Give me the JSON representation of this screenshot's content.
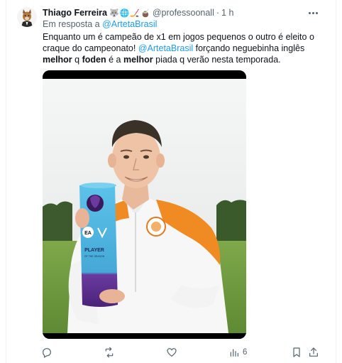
{
  "author": {
    "display_name": "Thiago Ferreira",
    "name_emojis": [
      "🐺",
      "🌐",
      "🏒",
      "🧉"
    ],
    "handle": "@professoonall",
    "separator": "·",
    "time": "1 h"
  },
  "reply": {
    "prefix": "Em resposta a ",
    "mention": "@ArtetaBrasil"
  },
  "tweet": {
    "part1": "Enquanto um é campeão de x1 em jogos pequenos o outro é eleito o craque do campeonato! ",
    "mention": "@ArtetaBrasil",
    "part2": " forçando neguebinha inglês ",
    "bold1": "melhor",
    "part3": " q ",
    "bold2": "foden",
    "part4": " é a ",
    "bold3": "melhor",
    "part5": " piada q verão nesta temporada."
  },
  "media": {
    "trophy_label": "PLAYER",
    "trophy_sublabel": "OF THE SEASON",
    "sponsor_label": "EA"
  },
  "actions": {
    "views_count": "6"
  },
  "colors": {
    "accent": "#1d9bf0",
    "text": "#0f1419",
    "muted": "#536471",
    "kit_orange": "#f08a22",
    "trophy_blue": "#4fb6e0",
    "trophy_purple": "#5a2a8a"
  },
  "icons": [
    "more-icon",
    "reply-icon",
    "retweet-icon",
    "like-icon",
    "views-icon",
    "bookmark-icon",
    "share-icon"
  ]
}
